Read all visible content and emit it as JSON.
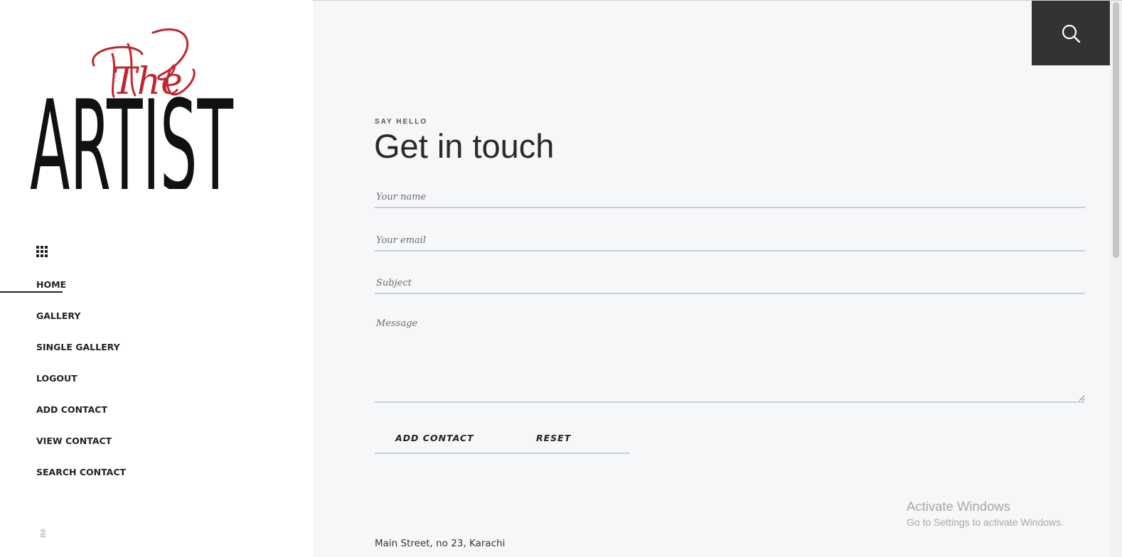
{
  "logo": {
    "script_text": "The",
    "main_text": "ARTIST",
    "script_color": "#c0272d",
    "main_color": "#111111"
  },
  "sidebar": {
    "menu_icon": "grid-icon",
    "items": [
      {
        "label": "HOME",
        "active": true
      },
      {
        "label": "GALLERY",
        "active": false
      },
      {
        "label": "SINGLE GALLERY",
        "active": false
      },
      {
        "label": "LOGOUT",
        "active": false
      },
      {
        "label": "ADD CONTACT",
        "active": false
      },
      {
        "label": "VIEW CONTACT",
        "active": false
      },
      {
        "label": "SEARCH CONTACT",
        "active": false
      }
    ],
    "social": "Bē"
  },
  "header": {
    "search_icon": "search-icon"
  },
  "contact": {
    "eyebrow": "SAY HELLO",
    "title": "Get in touch",
    "fields": {
      "name_placeholder": "Your name",
      "email_placeholder": "Your email",
      "subject_placeholder": "Subject",
      "message_placeholder": "Message"
    },
    "buttons": {
      "add": "ADD CONTACT",
      "reset": "RESET"
    },
    "address": "Main Street, no 23, Karachi"
  },
  "overlay": {
    "watermark_title": "Activate Windows",
    "watermark_sub": "Go to Settings to activate Windows."
  },
  "colors": {
    "accent_dark": "#333333",
    "background_main": "#f6f7f9",
    "field_line": "#c7d0de"
  }
}
